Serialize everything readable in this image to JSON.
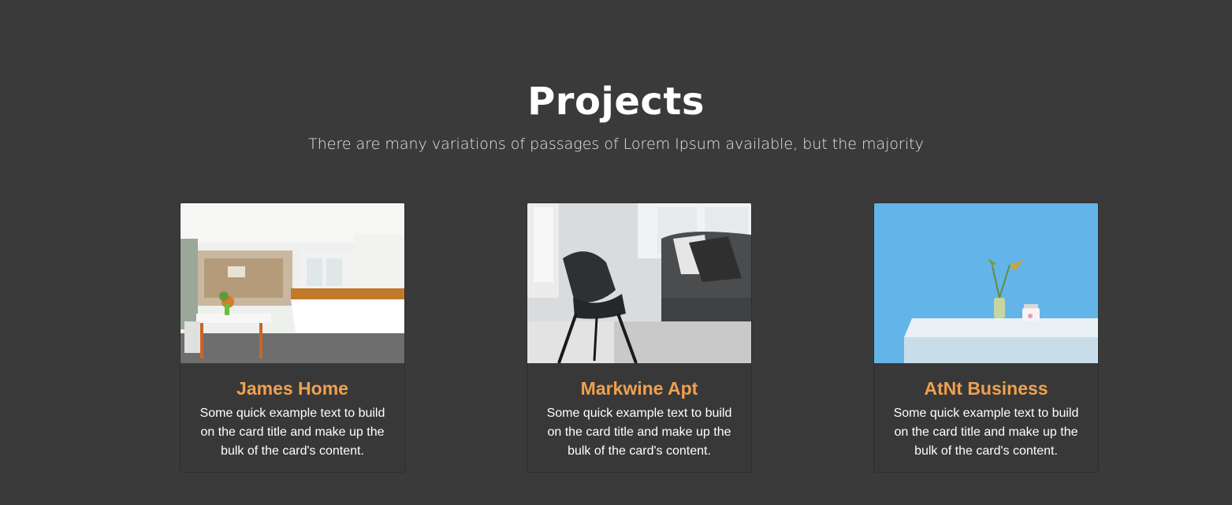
{
  "section": {
    "title": "Projects",
    "subtitle": "There are many variations of passages of Lorem Ipsum available, but the majority"
  },
  "cards": [
    {
      "title": "James Home",
      "text": "Some quick example text to build on the card title and make up the bulk of the card's content.",
      "image": "kitchen-interior-photo"
    },
    {
      "title": "Markwine Apt",
      "text": "Some quick example text to build on the card title and make up the bulk of the card's content.",
      "image": "living-room-chair-photo"
    },
    {
      "title": "AtNt Business",
      "text": "Some quick example text to build on the card title and make up the bulk of the card's content.",
      "image": "blue-wall-table-photo"
    }
  ],
  "colors": {
    "background": "#3a3a3a",
    "card_title": "#f0a050",
    "text": "#ffffff"
  }
}
